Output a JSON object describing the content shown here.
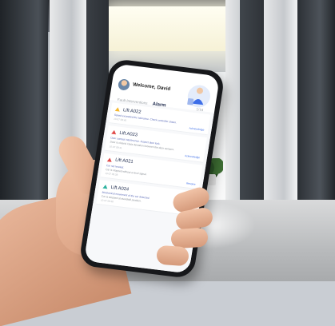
{
  "app": {
    "welcome_text": "Welcome, David",
    "tabs": [
      {
        "label": "Fault Interventions"
      },
      {
        "label": "Alarm",
        "active": true
      },
      {
        "label": "1/16"
      }
    ],
    "accent_color": "#3d6ee8",
    "alarms": [
      {
        "title": "Lift A022",
        "level_color": "#f5b82e",
        "desc": "Speed exceeded the tolerance. Check controller status.",
        "time": "10-07 09:45",
        "link": "Acknowledge"
      },
      {
        "title": "Lift A023",
        "level_color": "#e04b4b",
        "desc": "Door contact interference. Inspect door lock.",
        "desc2": "Door is closed. Data deviation between the door sensors.",
        "time": "10-07 09:41",
        "link": "Acknowledge"
      },
      {
        "title": "Lift A021",
        "level_color": "#e04b4b",
        "desc": "Car not leveled.",
        "desc2": "Car is stopped without a level signal.",
        "time": "10-07 09:38",
        "link": "Resolve"
      },
      {
        "title": "Lift A024",
        "level_color": "#2fb3a0",
        "desc": "Mechanical movement of the car detected.",
        "desc2": "Car is stopped at standstill position.",
        "time": "10-07 09:30",
        "link": "Resolve"
      }
    ]
  }
}
